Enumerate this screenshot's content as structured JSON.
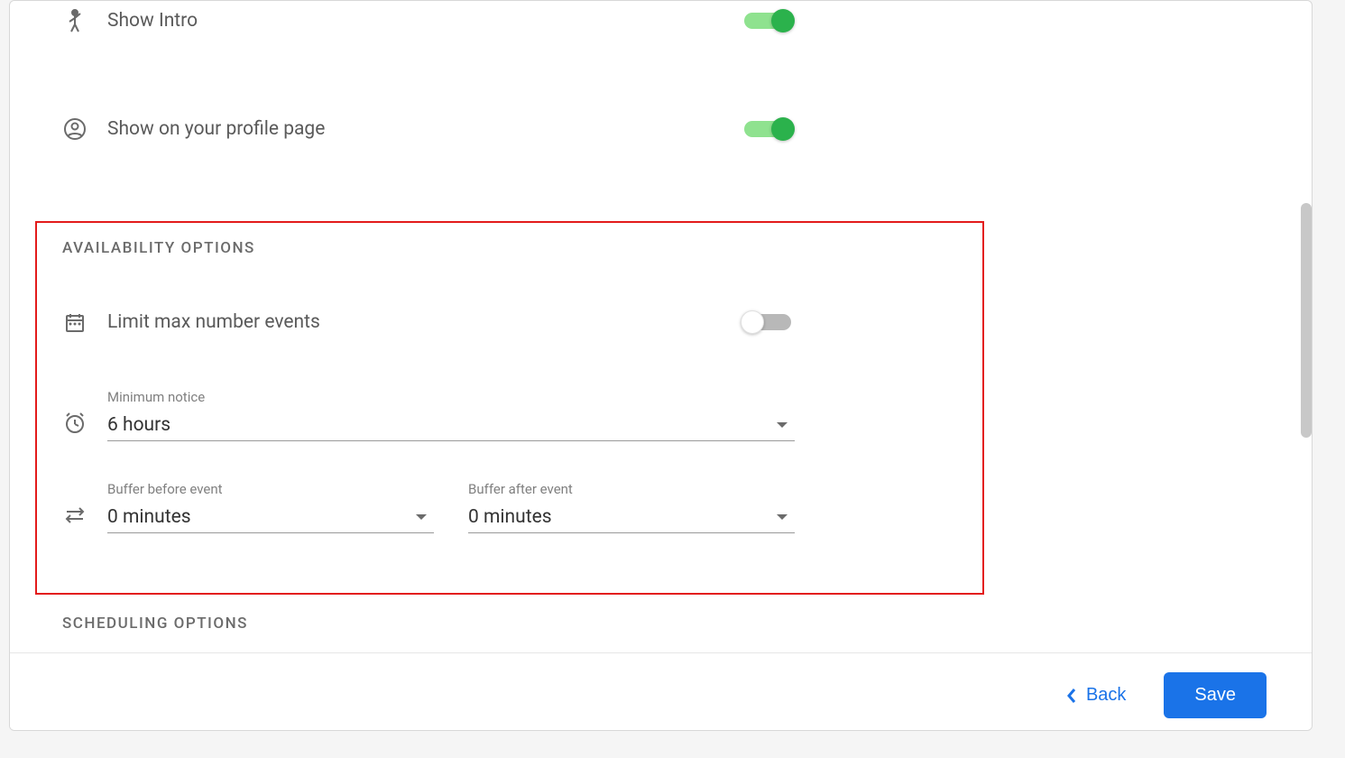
{
  "settings": {
    "show_intro": {
      "label": "Show Intro",
      "enabled": true
    },
    "show_profile": {
      "label": "Show on your profile page",
      "enabled": true
    }
  },
  "availability": {
    "header": "AVAILABILITY OPTIONS",
    "limit_max": {
      "label": "Limit max number events",
      "enabled": false
    },
    "minimum_notice": {
      "label": "Minimum notice",
      "value": "6 hours"
    },
    "buffer_before": {
      "label": "Buffer before event",
      "value": "0 minutes"
    },
    "buffer_after": {
      "label": "Buffer after event",
      "value": "0 minutes"
    }
  },
  "scheduling": {
    "header": "SCHEDULING OPTIONS"
  },
  "footer": {
    "back": "Back",
    "save": "Save"
  }
}
